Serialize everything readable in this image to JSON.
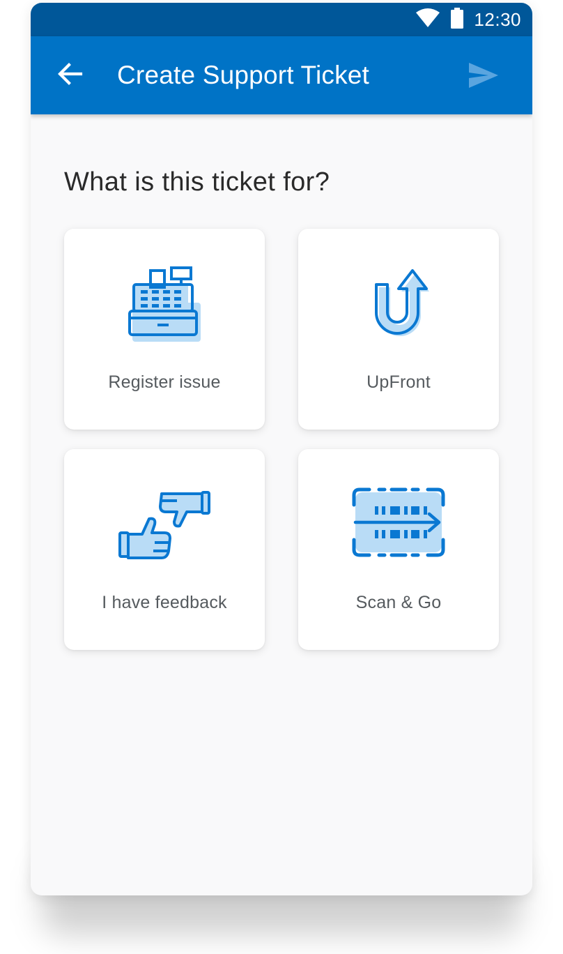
{
  "status_bar": {
    "time": "12:30",
    "icons": [
      "wifi-icon",
      "battery-icon"
    ]
  },
  "app_bar": {
    "title": "Create Support Ticket",
    "back_icon": "arrow-left-icon",
    "send_icon": "send-icon"
  },
  "main": {
    "question": "What is this ticket for?",
    "options": [
      {
        "label": "Register issue",
        "icon": "cash-register-icon"
      },
      {
        "label": "UpFront",
        "icon": "u-turn-arrow-icon"
      },
      {
        "label": "I have feedback",
        "icon": "thumbs-up-down-icon"
      },
      {
        "label": "Scan & Go",
        "icon": "barcode-scan-icon"
      }
    ]
  },
  "colors": {
    "status_bar": "#005799",
    "app_bar": "#0073c6",
    "icon_stroke": "#0a78d2",
    "icon_fill": "#b9dcf6",
    "background": "#f9f9fa"
  }
}
